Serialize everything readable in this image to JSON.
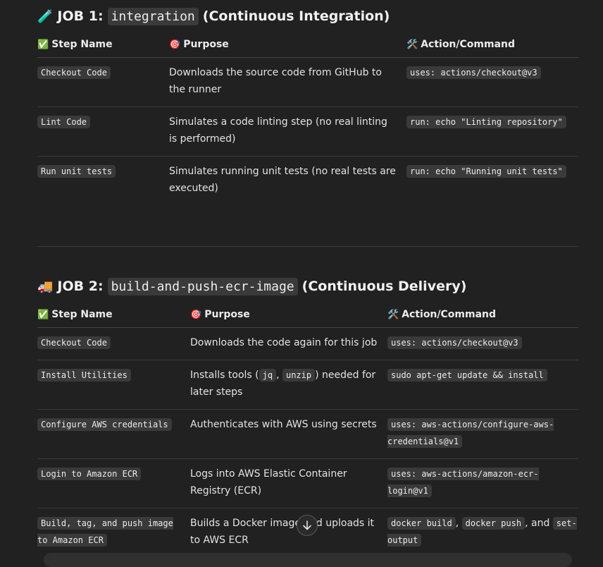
{
  "job1": {
    "emoji": "🧪",
    "prefix": "JOB 1:",
    "code": "integration",
    "suffix": "(Continuous Integration)",
    "headers": {
      "step": "Step Name",
      "purpose": "Purpose",
      "action": "Action/Command",
      "step_emoji": "✅",
      "purpose_emoji": "🎯",
      "action_emoji": "🛠️"
    },
    "rows": [
      {
        "step": "Checkout Code",
        "purpose": "Downloads the source code from GitHub to the runner",
        "action": "uses: actions/checkout@v3"
      },
      {
        "step": "Lint Code",
        "purpose": "Simulates a code linting step (no real linting is performed)",
        "action": "run: echo \"Linting repository\""
      },
      {
        "step": "Run unit tests",
        "purpose": "Simulates running unit tests (no real tests are executed)",
        "action": "run: echo \"Running unit tests\""
      }
    ]
  },
  "job2": {
    "emoji": "🚚",
    "prefix": "JOB 2:",
    "code": "build-and-push-ecr-image",
    "suffix": "(Continuous Delivery)",
    "headers": {
      "step": "Step Name",
      "purpose": "Purpose",
      "action": "Action/Command",
      "step_emoji": "✅",
      "purpose_emoji": "🎯",
      "action_emoji": "🛠️"
    },
    "rows": [
      {
        "step": "Checkout Code",
        "purpose": "Downloads the code again for this job",
        "action": "uses: actions/checkout@v3"
      },
      {
        "step": "Install Utilities",
        "purpose_pre": "Installs tools (",
        "purpose_code1": "jq",
        "purpose_mid": ", ",
        "purpose_code2": "unzip",
        "purpose_post": ") needed for later steps",
        "action": "sudo apt-get update && install"
      },
      {
        "step": "Configure AWS credentials",
        "purpose": "Authenticates with AWS using secrets",
        "action": "uses: aws-actions/configure-aws-credentials@v1"
      },
      {
        "step": "Login to Amazon ECR",
        "purpose": "Logs into AWS Elastic Container Registry (ECR)",
        "action": "uses: aws-actions/amazon-ecr-login@v1"
      },
      {
        "step": "Build, tag, and push image to Amazon ECR",
        "purpose": "Builds a Docker image and uploads it to AWS ECR",
        "action_code1": "docker build",
        "action_sep1": ", ",
        "action_code2": "docker push",
        "action_sep2": ", and ",
        "action_code3": "set-output"
      }
    ]
  },
  "scroll_icon": "arrow-down"
}
